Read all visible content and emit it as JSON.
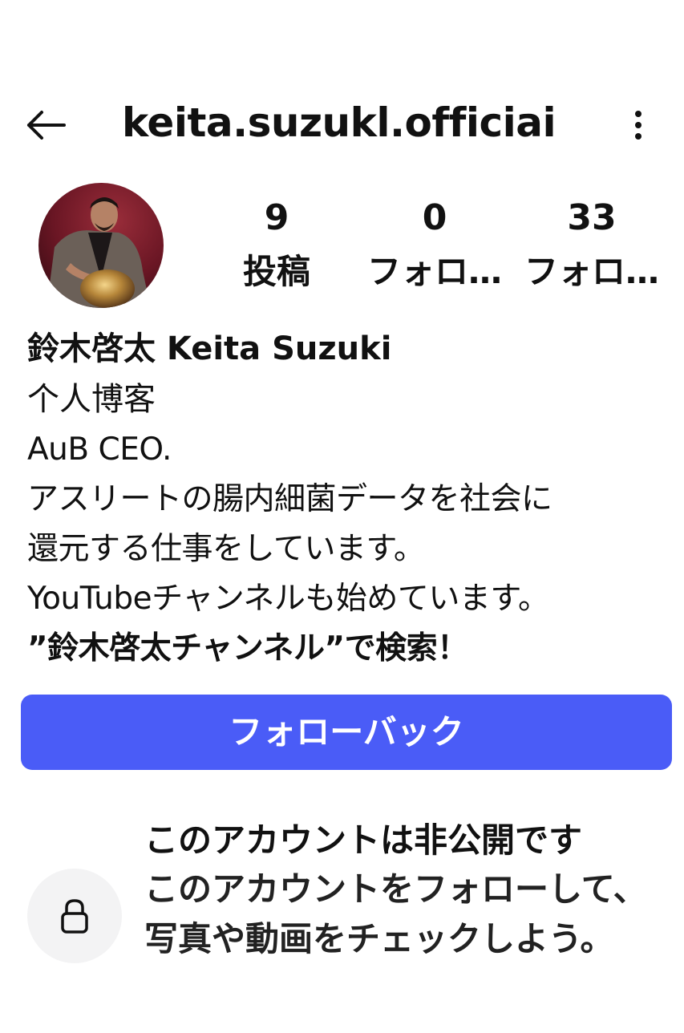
{
  "header": {
    "username": "keita.suzukl.officiai"
  },
  "stats": {
    "posts": {
      "count": "9",
      "label": "投稿"
    },
    "followers": {
      "count": "0",
      "label": "フォロ…"
    },
    "following": {
      "count": "33",
      "label": "フォロ…"
    }
  },
  "bio": {
    "display_name": "鈴木啓太 Keita Suzuki",
    "category": "个人博客",
    "lines": [
      "AuB CEO.",
      "アスリートの腸内細菌データを社会に",
      "還元する仕事をしています。",
      "YouTubeチャンネルも始めています。",
      "”鈴木啓太チャンネル”で検索！"
    ]
  },
  "actions": {
    "follow_back_label": "フォローバック"
  },
  "private_notice": {
    "title": "このアカウントは非公開です",
    "description": "このアカウントをフォローして、写真や動画をチェックしよう。"
  },
  "icons": {
    "back": "arrow-left-icon",
    "more": "more-vertical-icon",
    "lock": "lock-icon"
  },
  "colors": {
    "accent": "#4a5cf7",
    "text": "#111111",
    "lock_bg": "#f3f3f4"
  }
}
